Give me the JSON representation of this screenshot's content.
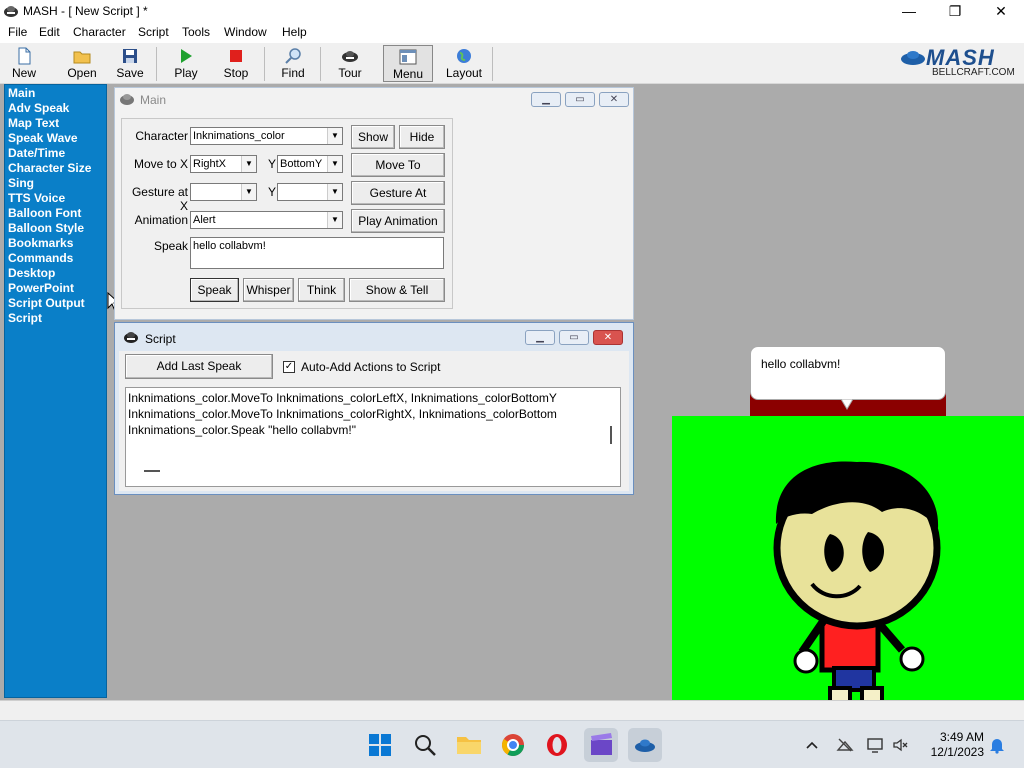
{
  "window": {
    "title": "MASH - [ New Script ] *",
    "controls": [
      "minimize",
      "maximize",
      "close"
    ]
  },
  "menubar": {
    "items": [
      "File",
      "Edit",
      "Character",
      "Script",
      "Tools",
      "Window",
      "Help"
    ]
  },
  "toolbar": {
    "items": [
      {
        "label": "New",
        "icon": "new-file-icon"
      },
      {
        "label": "Open",
        "icon": "open-folder-icon"
      },
      {
        "label": "Save",
        "icon": "save-disk-icon"
      },
      {
        "label": "Play",
        "icon": "play-icon"
      },
      {
        "label": "Stop",
        "icon": "stop-icon"
      },
      {
        "label": "Find",
        "icon": "find-icon"
      },
      {
        "label": "Tour",
        "icon": "tour-icon"
      },
      {
        "label": "Menu",
        "icon": "menu-icon"
      },
      {
        "label": "Layout",
        "icon": "globe-icon"
      }
    ],
    "pressed": "Menu"
  },
  "brand": {
    "logo": "MASH",
    "sub": "BELLCRAFT.COM"
  },
  "sidebar": {
    "items": [
      "Main",
      "Adv Speak",
      "Map Text",
      "Speak Wave",
      "Date/Time",
      "Character Size",
      "Sing",
      "TTS Voice",
      "Balloon Font",
      "Balloon Style",
      "Bookmarks",
      "Commands",
      "Desktop",
      "PowerPoint",
      "Script Output",
      "Script"
    ]
  },
  "main_window": {
    "title": "Main",
    "character_label": "Character",
    "character_value": "Inknimations_color",
    "show_label": "Show",
    "hide_label": "Hide",
    "moveto_label": "Move to X",
    "moveto_x": "RightX",
    "y_label": "Y",
    "moveto_y": "BottomY",
    "moveto_btn": "Move To",
    "gesture_label": "Gesture at X",
    "gesture_x": "",
    "gesture_y": "",
    "gesture_btn": "Gesture At",
    "animation_label": "Animation",
    "animation_value": "Alert",
    "play_animation_btn": "Play Animation",
    "speak_label": "Speak",
    "speak_text": "hello collabvm!",
    "buttons": [
      "Speak",
      "Whisper",
      "Think",
      "Show & Tell"
    ]
  },
  "script_window": {
    "title": "Script",
    "add_last_speak": "Add Last Speak",
    "auto_add_label": "Auto-Add Actions to Script",
    "auto_add_checked": true,
    "lines": [
      "Inknimations_color.MoveTo Inknimations_colorLeftX, Inknimations_colorBottomY",
      "Inknimations_color.MoveTo Inknimations_colorRightX, Inknimations_colorBottom",
      "Inknimations_color.Speak \"hello collabvm!\""
    ]
  },
  "stage": {
    "bubble_text": "hello collabvm!",
    "bg_color": "#00ff00",
    "bubble_bar_color": "#8b0000"
  },
  "taskbar": {
    "apps": [
      "windows-start-icon",
      "search-icon",
      "file-explorer-icon",
      "chrome-icon",
      "opera-icon",
      "clapper-icon",
      "mash-icon"
    ],
    "time": "3:49 AM",
    "date": "12/1/2023",
    "tray": [
      "chevron-up-icon",
      "network-icon",
      "display-icon",
      "volume-muted-icon",
      "notification-bell-icon"
    ]
  },
  "colors": {
    "sidebar": "#0a7fc8",
    "workspace": "#ababab",
    "accent": "#0078d4"
  }
}
